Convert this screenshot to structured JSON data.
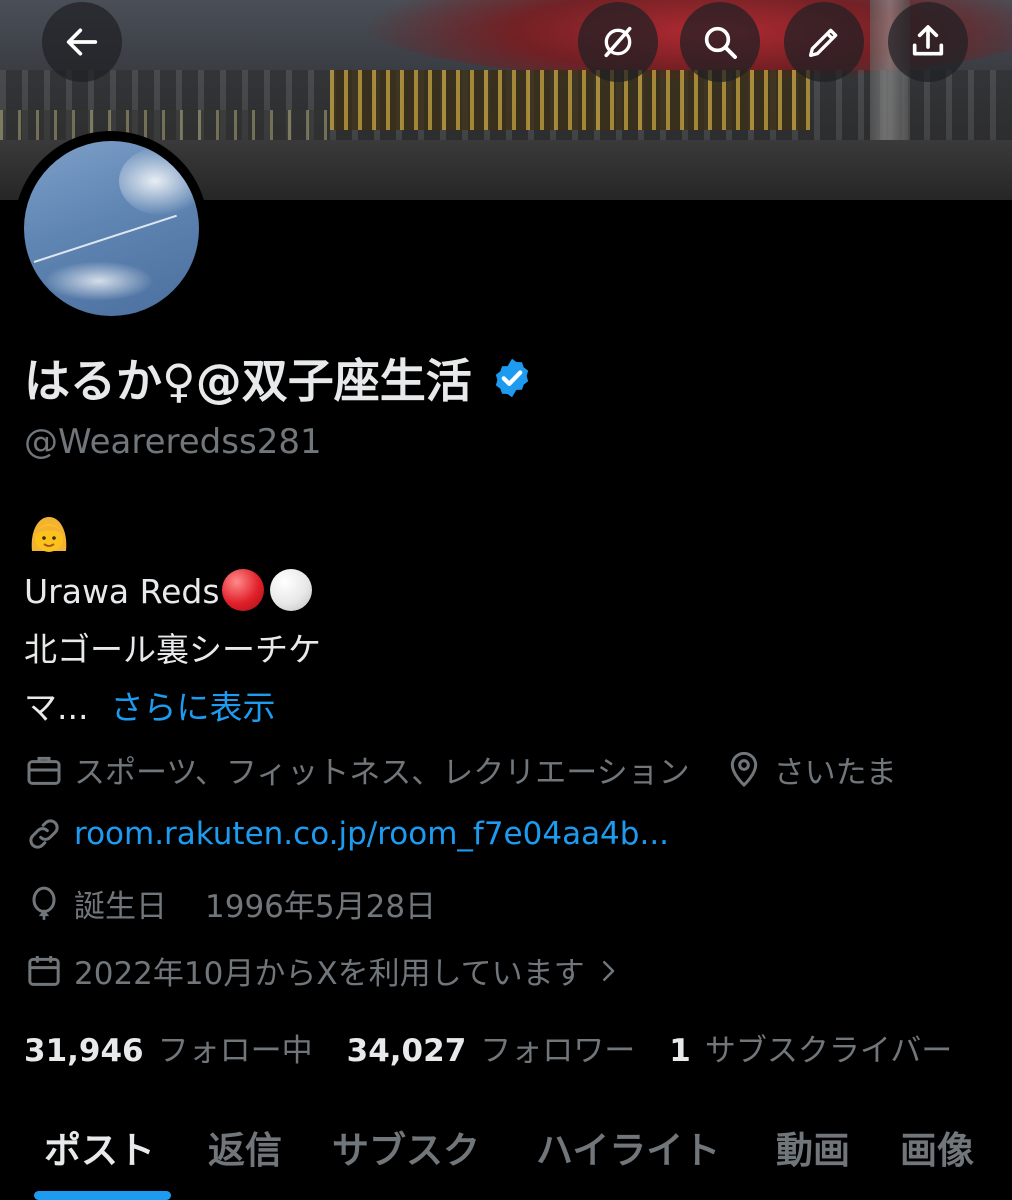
{
  "header": {
    "back_icon": "arrow-left-icon",
    "actions": [
      "grok-icon",
      "search-icon",
      "edit-icon",
      "share-icon"
    ]
  },
  "profile": {
    "display_name": "はるか♀@双子座生活",
    "verified_icon": "verified-badge-icon",
    "handle": "@Weareredss281",
    "bio_line1_emoji": "👩",
    "bio_line2": "Urawa Reds",
    "bio_line3": "北ゴール裏シーチケ",
    "bio_line4": "マ...",
    "show_more": "さらに表示",
    "category": "スポーツ、フィットネス、レクリエーション",
    "location": "さいたま",
    "link": "room.rakuten.co.jp/room_f7e04aa4b...",
    "birthday_label": "誕生日",
    "birthday": "1996年5月28日",
    "joined": "2022年10月からXを利用しています"
  },
  "stats": {
    "following_count": "31,946",
    "following_label": "フォロー中",
    "followers_count": "34,027",
    "followers_label": "フォロワー",
    "subscribers_count": "1",
    "subscribers_label": "サブスクライバー"
  },
  "tabs": [
    "ポスト",
    "返信",
    "サブスク",
    "ハイライト",
    "動画",
    "画像"
  ],
  "active_tab": "ポスト",
  "colors": {
    "background": "#000000",
    "text_primary": "#e7e9ea",
    "text_secondary": "#71767b",
    "accent": "#1d9bf0"
  }
}
